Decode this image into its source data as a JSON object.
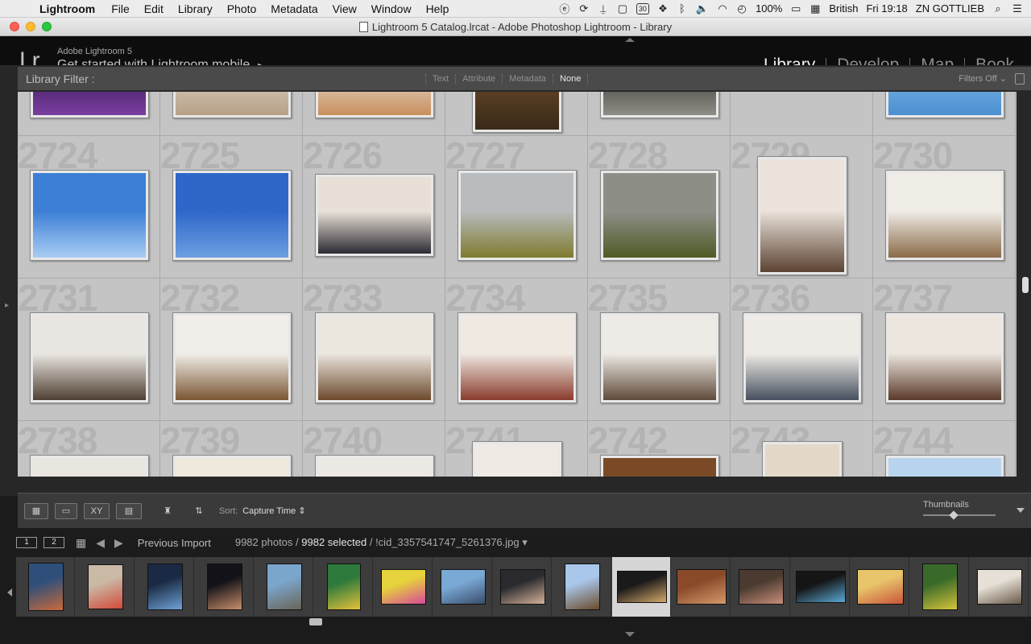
{
  "menubar": {
    "app": "Lightroom",
    "items": [
      "File",
      "Edit",
      "Library",
      "Photo",
      "Metadata",
      "View",
      "Window",
      "Help"
    ],
    "battery": "100%",
    "input_source": "British",
    "clock": "Fri 19:18",
    "user": "ZN GOTTLIEB",
    "calendar_day": "30"
  },
  "window": {
    "title": "Lightroom 5 Catalog.lrcat - Adobe Photoshop Lightroom - Library"
  },
  "identity": {
    "logo": "Lr",
    "product": "Adobe Lightroom 5",
    "promo": "Get started with Lightroom mobile",
    "promo_arrow": "▶"
  },
  "modules": [
    "Library",
    "Develop",
    "Map",
    "Book"
  ],
  "active_module": "Library",
  "filter_bar": {
    "label": "Library Filter :",
    "options": [
      "Text",
      "Attribute",
      "Metadata",
      "None"
    ],
    "active": "None",
    "preset": "Filters Off"
  },
  "grid": {
    "rows": [
      {
        "cells": [
          {
            "index": "",
            "photo": {
              "colors": [
                "#3a1a5a",
                "#7a3fa0"
              ]
            }
          },
          {
            "index": "",
            "photo": {
              "colors": [
                "#dcd3c6",
                "#b79f86"
              ]
            }
          },
          {
            "index": "",
            "photo": {
              "colors": [
                "#e4ddd3",
                "#c98f5c"
              ]
            }
          },
          {
            "index": "",
            "photo": {
              "colors": [
                "#6b4a2a",
                "#3a2a18"
              ]
            }
          },
          {
            "index": "",
            "photo": {
              "colors": [
                "#3d3b35",
                "#8e8d86"
              ]
            }
          },
          {
            "index": "",
            "photo": null
          },
          {
            "index": "",
            "photo": {
              "colors": [
                "#7fb7e6",
                "#4a8fd1"
              ]
            }
          }
        ]
      },
      {
        "cells": [
          {
            "index": "2724",
            "photo": {
              "colors": [
                "#3d7fd6",
                "#a8cdf3"
              ]
            }
          },
          {
            "index": "2725",
            "photo": {
              "colors": [
                "#2f67c9",
                "#6d9fe0"
              ]
            }
          },
          {
            "index": "2726",
            "photo": {
              "colors": [
                "#e8e0d6",
                "#2d2b33"
              ]
            }
          },
          {
            "index": "2727",
            "photo": {
              "colors": [
                "#b8bcbe",
                "#7f7a2e"
              ]
            }
          },
          {
            "index": "2728",
            "photo": {
              "colors": [
                "#8d8f87",
                "#4f5b27"
              ]
            }
          },
          {
            "index": "2729",
            "photo": {
              "colors": [
                "#ece4dc",
                "#5c4332"
              ]
            }
          },
          {
            "index": "2730",
            "photo": {
              "colors": [
                "#f0ece6",
                "#8a6a48"
              ]
            }
          }
        ]
      },
      {
        "cells": [
          {
            "index": "2731",
            "photo": {
              "colors": [
                "#e9e6e1",
                "#4f3f32"
              ]
            }
          },
          {
            "index": "2732",
            "photo": {
              "colors": [
                "#f1eee9",
                "#7b5634"
              ]
            }
          },
          {
            "index": "2733",
            "photo": {
              "colors": [
                "#ebe6de",
                "#6e4a2c"
              ]
            }
          },
          {
            "index": "2734",
            "photo": {
              "colors": [
                "#efe9e2",
                "#8a3b2d"
              ]
            }
          },
          {
            "index": "2735",
            "photo": {
              "colors": [
                "#eeeae5",
                "#5f4a3a"
              ]
            }
          },
          {
            "index": "2736",
            "photo": {
              "colors": [
                "#efebe6",
                "#47505e"
              ]
            }
          },
          {
            "index": "2737",
            "photo": {
              "colors": [
                "#ece6de",
                "#5a3a2a"
              ]
            }
          }
        ]
      },
      {
        "cells": [
          {
            "index": "2738",
            "photo": {
              "colors": [
                "#e9e5df",
                "#7a6a55"
              ]
            }
          },
          {
            "index": "2739",
            "photo": {
              "colors": [
                "#efe8dc",
                "#a36f3d"
              ]
            }
          },
          {
            "index": "2740",
            "photo": {
              "colors": [
                "#ece8e3",
                "#5d5a55"
              ]
            }
          },
          {
            "index": "2741",
            "photo": {
              "colors": [
                "#efeae4",
                "#4c4137"
              ]
            }
          },
          {
            "index": "2742",
            "photo": {
              "colors": [
                "#7a4a26",
                "#2b2018"
              ]
            }
          },
          {
            "index": "2743",
            "photo": {
              "colors": [
                "#e4d8c8",
                "#6a4a36"
              ]
            }
          },
          {
            "index": "2744",
            "photo": {
              "colors": [
                "#b9d4ee",
                "#7a7a5a"
              ]
            }
          }
        ]
      }
    ]
  },
  "toolbar": {
    "sort_label": "Sort:",
    "sort_value": "Capture Time",
    "thumbnails_label": "Thumbnails",
    "thumbnail_size": 0.4
  },
  "filmstrip_header": {
    "screen1": "1",
    "screen2": "2",
    "source": "Previous Import",
    "photo_count": "9982 photos /",
    "selected": "9982 selected",
    "filename": "/ !cid_3357541747_5261376.jpg"
  },
  "filmstrip": [
    {
      "colors": [
        "#2f4f7a",
        "#c96a3a"
      ],
      "selected": false
    },
    {
      "colors": [
        "#c9b9a5",
        "#d44a3a"
      ],
      "selected": false
    },
    {
      "colors": [
        "#1a2a44",
        "#6fa3d6"
      ],
      "selected": false
    },
    {
      "colors": [
        "#121218",
        "#c98e6a"
      ],
      "selected": false
    },
    {
      "colors": [
        "#7aa6cc",
        "#6a6458"
      ],
      "selected": false
    },
    {
      "colors": [
        "#2e7a3c",
        "#e6c23a"
      ],
      "selected": false
    },
    {
      "colors": [
        "#e6d23a",
        "#d64a9a"
      ],
      "selected": false
    },
    {
      "colors": [
        "#7aa9d6",
        "#394d6a"
      ],
      "selected": false
    },
    {
      "colors": [
        "#2a2a2e",
        "#d6b39a"
      ],
      "selected": false
    },
    {
      "colors": [
        "#a9c7ea",
        "#6a4a2a"
      ],
      "selected": false
    },
    {
      "colors": [
        "#1a1a1a",
        "#d6a96a"
      ],
      "selected": true
    },
    {
      "colors": [
        "#8a4a2a",
        "#d69a6a"
      ],
      "selected": false
    },
    {
      "colors": [
        "#4a3a30",
        "#c98e7a"
      ],
      "selected": false
    },
    {
      "colors": [
        "#151515",
        "#5aa9d6"
      ],
      "selected": false
    },
    {
      "colors": [
        "#e8c46a",
        "#c9553a"
      ],
      "selected": false
    },
    {
      "colors": [
        "#3a6a2a",
        "#d6c43a"
      ],
      "selected": false
    },
    {
      "colors": [
        "#e6e0d6",
        "#6a5a4a"
      ],
      "selected": false
    },
    {
      "colors": [
        "#5a5a5a",
        "#a0a0a0"
      ],
      "selected": false
    }
  ]
}
